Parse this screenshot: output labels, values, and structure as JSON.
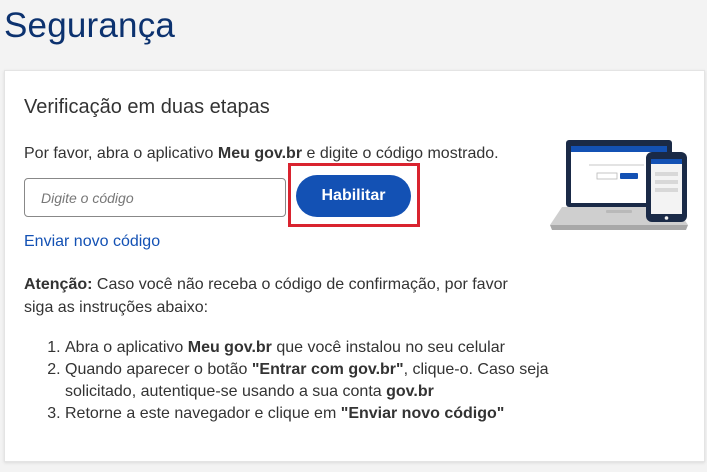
{
  "page": {
    "title": "Segurança"
  },
  "card": {
    "title": "Verificação em duas etapas",
    "instruction": {
      "prefix": "Por favor, abra o aplicativo ",
      "app_name": "Meu gov.br",
      "suffix": " e digite o código mostrado."
    },
    "code_input": {
      "placeholder": "Digite o código",
      "value": ""
    },
    "enable_button_label": "Habilitar",
    "resend_link": "Enviar novo código",
    "warning": {
      "label": "Atenção:",
      "text": " Caso você não receba o código de confirmação, por favor siga as instruções abaixo:"
    },
    "steps": [
      {
        "prefix": "Abra o aplicativo ",
        "bold": "Meu gov.br",
        "suffix": " que você instalou no seu celular"
      },
      {
        "prefix": "Quando aparecer o botão ",
        "bold": "\"Entrar com gov.br\"",
        "middle": ", clique-o. Caso seja solicitado, autentique-se usando a sua conta ",
        "bold2": "gov.br"
      },
      {
        "prefix": "Retorne a este navegador e clique em ",
        "bold": "\"Enviar novo código\""
      }
    ],
    "illustration_icon": "laptop-and-phone-illustration"
  },
  "colors": {
    "title": "#0c326f",
    "primary": "#1351b4",
    "highlight": "#d9232f",
    "text": "#333333"
  }
}
